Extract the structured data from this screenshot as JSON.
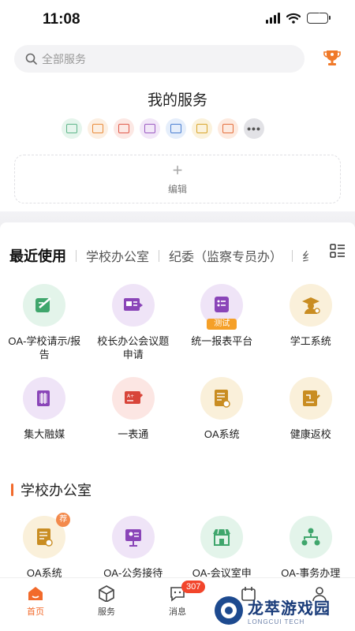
{
  "status_bar": {
    "time": "11:08"
  },
  "search": {
    "placeholder": "全部服务"
  },
  "my_services": {
    "title": "我的服务",
    "icons": [
      {
        "name": "pen-doc-icon",
        "color": "#5fb58a",
        "bg": "#e5f5ec"
      },
      {
        "name": "doc-icon",
        "color": "#e98b3a",
        "bg": "#fcefe2"
      },
      {
        "name": "board-icon",
        "color": "#e05a4b",
        "bg": "#fce8e4"
      },
      {
        "name": "card-icon",
        "color": "#9b5bc2",
        "bg": "#f2e7f8"
      },
      {
        "name": "id-card-icon",
        "color": "#4b7fd1",
        "bg": "#e5eefb"
      },
      {
        "name": "file-icon",
        "color": "#d8a52c",
        "bg": "#fbf2dc"
      },
      {
        "name": "store-icon",
        "color": "#e46f3d",
        "bg": "#fdeadf"
      }
    ],
    "more_label": "•••",
    "edit_plus": "+",
    "edit_label": "编辑"
  },
  "tabs": [
    {
      "label": "最近使用",
      "active": true
    },
    {
      "label": "学校办公室",
      "active": false
    },
    {
      "label": "纪委（监察专员办）",
      "active": false
    },
    {
      "label": "纟",
      "active": false
    }
  ],
  "recent_apps": [
    {
      "label": "OA-学校请示/报告",
      "icon": "pen-doc-icon",
      "color": "#3fa66c",
      "bg": "#e3f4ea"
    },
    {
      "label": "校长办公会议题申请",
      "icon": "presentation-icon",
      "color": "#8a45b8",
      "bg": "#efe4f7"
    },
    {
      "label": "统一报表平台",
      "icon": "report-list-icon",
      "color": "#8a45b8",
      "bg": "#efe4f7",
      "badge": "测试"
    },
    {
      "label": "学工系统",
      "icon": "graduate-icon",
      "color": "#c98d22",
      "bg": "#faf0da"
    },
    {
      "label": "集大融媒",
      "icon": "media-icon",
      "color": "#8a45b8",
      "bg": "#efe4f7"
    },
    {
      "label": "一表通",
      "icon": "form-pen-icon",
      "color": "#d8453a",
      "bg": "#fce6e3"
    },
    {
      "label": "OA系统",
      "icon": "oa-doc-icon",
      "color": "#c98d22",
      "bg": "#faf0da"
    },
    {
      "label": "健康返校",
      "icon": "health-doc-icon",
      "color": "#c98d22",
      "bg": "#faf0da"
    }
  ],
  "section": {
    "title": "学校办公室"
  },
  "office_apps": [
    {
      "label": "OA系统",
      "icon": "oa-doc-icon",
      "color": "#c98d22",
      "bg": "#faf0da",
      "badge": "荐"
    },
    {
      "label": "OA-公务接待",
      "icon": "reception-icon",
      "color": "#8a45b8",
      "bg": "#efe4f7"
    },
    {
      "label": "OA-会议室申",
      "icon": "store-icon",
      "color": "#3fa66c",
      "bg": "#e3f4ea"
    },
    {
      "label": "OA-事务办理",
      "icon": "workflow-icon",
      "color": "#3fa66c",
      "bg": "#e3f4ea"
    }
  ],
  "bottom_nav": [
    {
      "label": "首页",
      "icon": "home-icon",
      "active": true
    },
    {
      "label": "服务",
      "icon": "cube-icon",
      "active": false
    },
    {
      "label": "消息",
      "icon": "chat-icon",
      "active": false,
      "badge": "307"
    },
    {
      "label": "",
      "icon": "calendar-icon",
      "active": false
    },
    {
      "label": "",
      "icon": "profile-icon",
      "active": false
    }
  ],
  "watermark": {
    "cn": "龙萃游戏园",
    "en": "LONGCUI TECH"
  }
}
